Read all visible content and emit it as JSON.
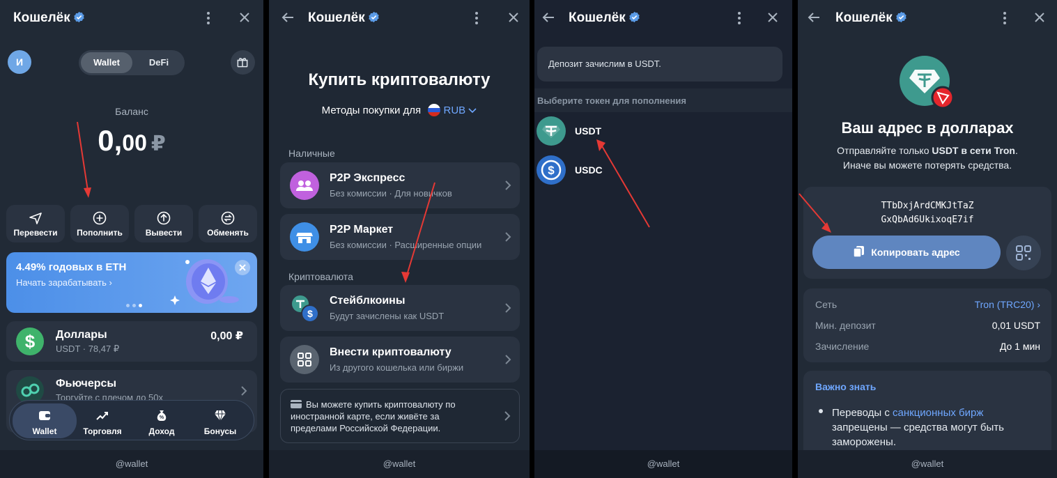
{
  "app": {
    "title": "Кошелёк",
    "footer": "@wallet"
  },
  "panel1": {
    "avatar": "И",
    "segments": [
      "Wallet",
      "DeFi"
    ],
    "balance_label": "Баланс",
    "balance_int": "0,",
    "balance_dec": "00",
    "balance_currency": "₽",
    "actions": [
      "Перевести",
      "Пополнить",
      "Вывести",
      "Обменять"
    ],
    "banner": {
      "title": "4.49% годовых в ETH",
      "link": "Начать зарабатывать"
    },
    "assets": [
      {
        "name": "Доллары",
        "sub": "USDT · 78,47 ₽",
        "value": "0,00 ₽"
      },
      {
        "name": "Фьючерсы",
        "sub": "Торгуйте с плечом до 50х"
      }
    ],
    "nav": [
      "Wallet",
      "Торговля",
      "Доход",
      "Бонусы"
    ]
  },
  "panel2": {
    "heading": "Купить криптовалюту",
    "methods_label": "Методы покупки для",
    "currency": "RUB",
    "section_cash": "Наличные",
    "section_crypto": "Криптовалюта",
    "rows": [
      {
        "title": "P2P Экспресс",
        "sub": "Без комиссии · Для новичков"
      },
      {
        "title": "P2P Маркет",
        "sub": "Без комиссии · Расширенные опции"
      },
      {
        "title": "Стейблкоины",
        "sub": "Будут зачислены как USDT"
      },
      {
        "title": "Внести криптовалюту",
        "sub": "Из другого кошелька или биржи"
      }
    ],
    "note_lines": [
      "Вы можете купить криптовалюту по",
      "иностранной карте, если живёте за",
      "пределами Российской Федерации."
    ]
  },
  "panel3": {
    "deposit_note": "Депозит зачислим в USDT.",
    "choose_label": "Выберите токен для пополнения",
    "tokens": [
      "USDT",
      "USDC"
    ]
  },
  "panel4": {
    "heading": "Ваш адрес в долларах",
    "warn1_pre": "Отправляйте только ",
    "warn1_bold": "USDT в сети Tron",
    "warn1_post": ".",
    "warn2": "Иначе вы можете потерять средства.",
    "address_line1": "TTbDxjArdCMKJtTaZ",
    "address_line2": "GxQbAd6UkixoqE7if",
    "copy_label": "Копировать адрес",
    "info": [
      {
        "key": "Сеть",
        "value": "Tron (TRC20)"
      },
      {
        "key": "Мин. депозит",
        "value": "0,01 USDT"
      },
      {
        "key": "Зачисление",
        "value": "До 1 мин"
      }
    ],
    "know_title": "Важно знать",
    "know_pre": "Переводы с ",
    "know_link": "санкционных бирж",
    "know_line2": "запрещены — средства могут быть",
    "know_line3": "заморожены."
  },
  "colors": {
    "accent": "#5f86c0",
    "link": "#6fa7ff",
    "arrow": "#e53935",
    "usdt": "#3e9a8e",
    "usdc": "#2f6fc9"
  }
}
